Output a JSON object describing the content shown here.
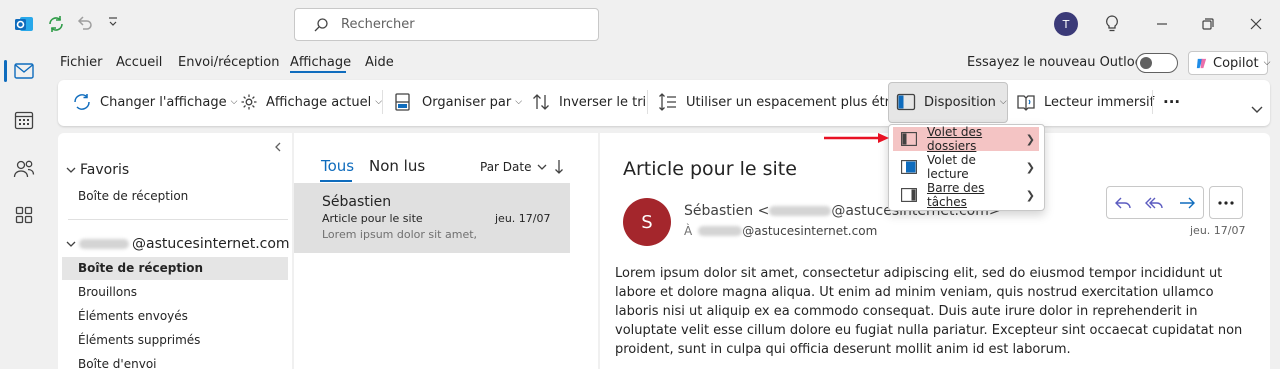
{
  "search": {
    "placeholder": "Rechercher"
  },
  "account": {
    "initial": "T"
  },
  "menu": {
    "tabs": [
      "Fichier",
      "Accueil",
      "Envoi/réception",
      "Affichage",
      "Aide"
    ],
    "try_new_outlook": "Essayez le nouveau Outlook",
    "copilot_label": "Copilot"
  },
  "ribbon": {
    "change_view": "Changer l'affichage",
    "current_view": "Affichage actuel",
    "arrange_by": "Organiser par",
    "reverse_sort": "Inverser le tri",
    "narrow_spacing": "Utiliser un espacement plus étroit",
    "layout": "Disposition",
    "immersive_reader": "Lecteur immersif",
    "more": "···"
  },
  "layout_menu": {
    "items": [
      {
        "label": "Volet des dossiers",
        "highlighted": true
      },
      {
        "label": "Volet de lecture",
        "highlighted": false
      },
      {
        "label": "Barre des tâches",
        "highlighted": false
      }
    ]
  },
  "folders": {
    "favorites_header": "Favoris",
    "favorites": [
      "Boîte de réception"
    ],
    "account_domain": "@astucesinternet.com",
    "items": [
      "Boîte de réception",
      "Brouillons",
      "Éléments envoyés",
      "Éléments supprimés",
      "Boîte d'envoi"
    ],
    "selected": "Boîte de réception"
  },
  "message_list": {
    "tab_all": "Tous",
    "tab_unread": "Non lus",
    "sort_label": "Par Date",
    "messages": [
      {
        "sender": "Sébastien",
        "subject": "Article pour le site",
        "date": "jeu. 17/07",
        "preview": "Lorem ipsum dolor sit amet,"
      }
    ]
  },
  "reading": {
    "subject": "Article pour le site",
    "avatar_initial": "S",
    "from_name": "Sébastien <",
    "from_domain": "@astucesinternet.com>",
    "to_label": "À",
    "to_domain": "@astucesinternet.com",
    "date": "jeu. 17/07",
    "body": "Lorem ipsum dolor sit amet, consectetur adipiscing elit, sed do eiusmod tempor incididunt ut labore et dolore magna aliqua. Ut enim ad minim veniam, quis nostrud exercitation ullamco laboris nisi ut aliquip ex ea commodo consequat. Duis aute irure dolor in reprehenderit in voluptate velit esse cillum dolore eu fugiat nulla pariatur. Excepteur sint occaecat cupidatat non proident, sunt in culpa qui officia deserunt mollit anim id est laborum."
  },
  "colors": {
    "accent": "#0f6cbd",
    "highlight": "#f4c4c4",
    "arrow": "#e81123",
    "avatar": "#a4262c"
  }
}
